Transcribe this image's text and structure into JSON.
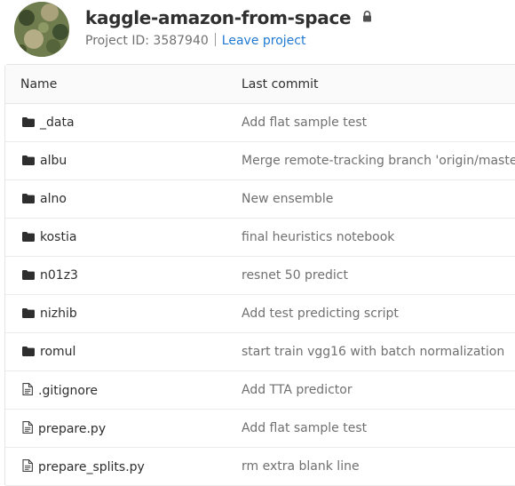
{
  "project": {
    "title": "kaggle-amazon-from-space",
    "id_text": "Project ID: 3587940",
    "leave_label": "Leave project"
  },
  "table": {
    "headers": {
      "name": "Name",
      "last_commit": "Last commit"
    },
    "rows": [
      {
        "name": "_data",
        "type": "folder",
        "commit": "Add flat sample test"
      },
      {
        "name": "albu",
        "type": "folder",
        "commit": "Merge remote-tracking branch 'origin/master'"
      },
      {
        "name": "alno",
        "type": "folder",
        "commit": "New ensemble"
      },
      {
        "name": "kostia",
        "type": "folder",
        "commit": "final heuristics notebook"
      },
      {
        "name": "n01z3",
        "type": "folder",
        "commit": "resnet 50 predict"
      },
      {
        "name": "nizhib",
        "type": "folder",
        "commit": "Add test predicting script"
      },
      {
        "name": "romul",
        "type": "folder",
        "commit": "start train vgg16 with batch normalization"
      },
      {
        "name": ".gitignore",
        "type": "file",
        "commit": "Add TTA predictor"
      },
      {
        "name": "prepare.py",
        "type": "file",
        "commit": "Add flat sample test"
      },
      {
        "name": "prepare_splits.py",
        "type": "file",
        "commit": "rm extra blank line"
      }
    ]
  },
  "icons": {
    "folder": "folder-icon",
    "file": "file-icon",
    "lock": "lock-icon"
  },
  "colors": {
    "link": "#1f78d1",
    "text": "#2e2e2e",
    "muted": "#707070"
  }
}
